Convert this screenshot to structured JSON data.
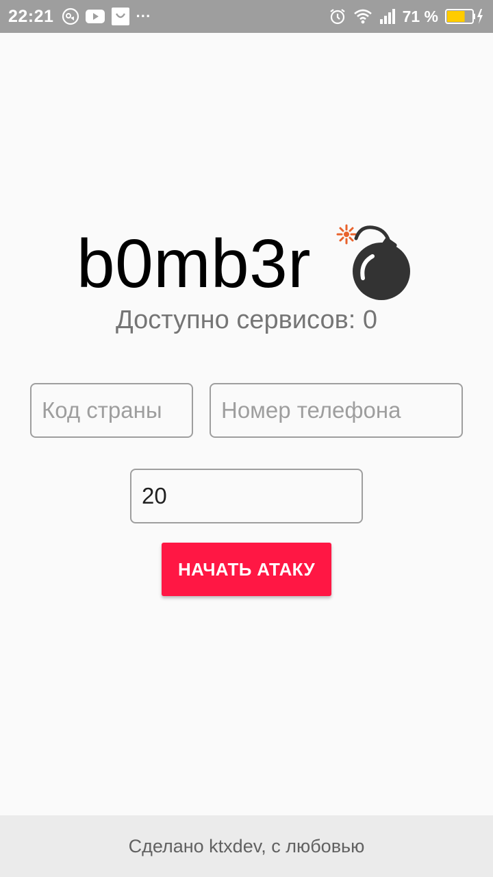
{
  "status_bar": {
    "time": "22:21",
    "left_icons": [
      "messenger-icon",
      "youtube-icon",
      "shopping-bag-icon",
      "more-notifications-icon"
    ],
    "right_icons": [
      "alarm-icon",
      "wifi-icon",
      "signal-icon",
      "battery-icon"
    ],
    "more_dots": "···",
    "battery_percent": "71 %",
    "battery_level": 0.71,
    "battery_color": "#ffcc00"
  },
  "app": {
    "title": "b0mb3r",
    "title_icon": "bomb-icon",
    "services_label": "Доступно сервисов: 0"
  },
  "form": {
    "country_code": {
      "placeholder": "Код страны",
      "value": ""
    },
    "phone_number": {
      "placeholder": "Номер телефона",
      "value": ""
    },
    "count": {
      "placeholder": "",
      "value": "20"
    },
    "start_button_label": "НАЧАТЬ АТАКУ"
  },
  "footer": {
    "text": "Сделано ktxdev, с любовью"
  },
  "colors": {
    "accent": "#ff1744",
    "status_bar_bg": "#9e9e9e",
    "background": "#fafafa",
    "footer_bg": "#ebebeb"
  }
}
